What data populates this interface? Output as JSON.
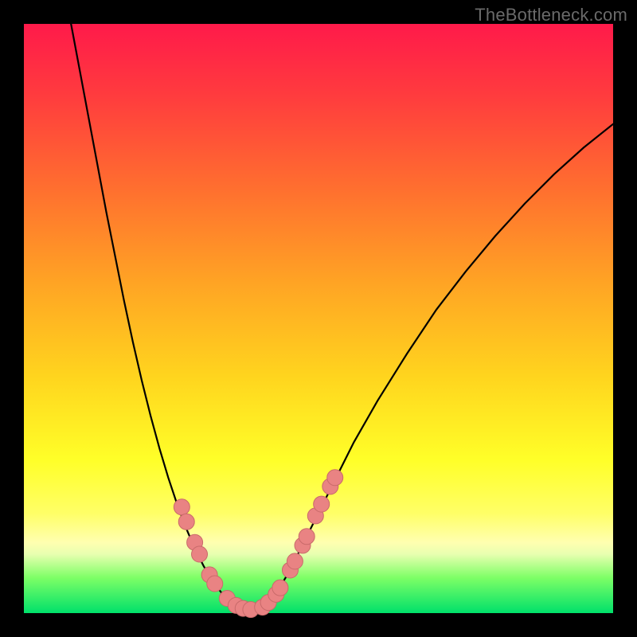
{
  "watermark": "TheBottleneck.com",
  "colors": {
    "curve_stroke": "#000000",
    "dot_fill": "#e98383",
    "dot_stroke": "#c96a6a"
  },
  "chart_data": {
    "type": "line",
    "title": "",
    "xlabel": "",
    "ylabel": "",
    "xlim": [
      0,
      100
    ],
    "ylim": [
      0,
      100
    ],
    "curve": [
      {
        "x": 8.0,
        "y": 100.0
      },
      {
        "x": 9.5,
        "y": 92.0
      },
      {
        "x": 11.0,
        "y": 84.0
      },
      {
        "x": 12.5,
        "y": 76.0
      },
      {
        "x": 14.0,
        "y": 68.0
      },
      {
        "x": 15.5,
        "y": 60.5
      },
      {
        "x": 17.0,
        "y": 53.0
      },
      {
        "x": 18.5,
        "y": 46.0
      },
      {
        "x": 20.0,
        "y": 39.5
      },
      {
        "x": 21.5,
        "y": 33.5
      },
      {
        "x": 23.0,
        "y": 28.0
      },
      {
        "x": 24.5,
        "y": 23.0
      },
      {
        "x": 26.0,
        "y": 18.5
      },
      {
        "x": 27.5,
        "y": 14.5
      },
      {
        "x": 29.0,
        "y": 11.0
      },
      {
        "x": 30.5,
        "y": 8.0
      },
      {
        "x": 32.0,
        "y": 5.5
      },
      {
        "x": 33.5,
        "y": 3.5
      },
      {
        "x": 35.0,
        "y": 2.0
      },
      {
        "x": 36.5,
        "y": 1.0
      },
      {
        "x": 38.0,
        "y": 0.5
      },
      {
        "x": 39.0,
        "y": 0.5
      },
      {
        "x": 40.5,
        "y": 1.0
      },
      {
        "x": 42.0,
        "y": 2.5
      },
      {
        "x": 43.5,
        "y": 4.5
      },
      {
        "x": 45.0,
        "y": 7.0
      },
      {
        "x": 46.5,
        "y": 10.0
      },
      {
        "x": 48.0,
        "y": 13.0
      },
      {
        "x": 50.0,
        "y": 17.0
      },
      {
        "x": 53.0,
        "y": 23.0
      },
      {
        "x": 56.0,
        "y": 29.0
      },
      {
        "x": 60.0,
        "y": 36.0
      },
      {
        "x": 65.0,
        "y": 44.0
      },
      {
        "x": 70.0,
        "y": 51.5
      },
      {
        "x": 75.0,
        "y": 58.0
      },
      {
        "x": 80.0,
        "y": 64.0
      },
      {
        "x": 85.0,
        "y": 69.5
      },
      {
        "x": 90.0,
        "y": 74.5
      },
      {
        "x": 95.0,
        "y": 79.0
      },
      {
        "x": 100.0,
        "y": 83.0
      }
    ],
    "dots_left": [
      {
        "x": 26.8,
        "y": 18.0
      },
      {
        "x": 27.6,
        "y": 15.5
      },
      {
        "x": 29.0,
        "y": 12.0
      },
      {
        "x": 29.8,
        "y": 10.0
      },
      {
        "x": 31.5,
        "y": 6.5
      },
      {
        "x": 32.4,
        "y": 5.0
      },
      {
        "x": 34.5,
        "y": 2.5
      },
      {
        "x": 36.0,
        "y": 1.3
      },
      {
        "x": 37.2,
        "y": 0.8
      },
      {
        "x": 38.5,
        "y": 0.6
      }
    ],
    "dots_right": [
      {
        "x": 40.5,
        "y": 1.0
      },
      {
        "x": 41.5,
        "y": 1.8
      },
      {
        "x": 42.8,
        "y": 3.2
      },
      {
        "x": 43.5,
        "y": 4.3
      },
      {
        "x": 45.2,
        "y": 7.3
      },
      {
        "x": 46.0,
        "y": 8.8
      },
      {
        "x": 47.3,
        "y": 11.5
      },
      {
        "x": 48.0,
        "y": 13.0
      },
      {
        "x": 49.5,
        "y": 16.5
      },
      {
        "x": 50.5,
        "y": 18.5
      },
      {
        "x": 52.0,
        "y": 21.5
      },
      {
        "x": 52.8,
        "y": 23.0
      }
    ],
    "dot_radius": 10
  }
}
